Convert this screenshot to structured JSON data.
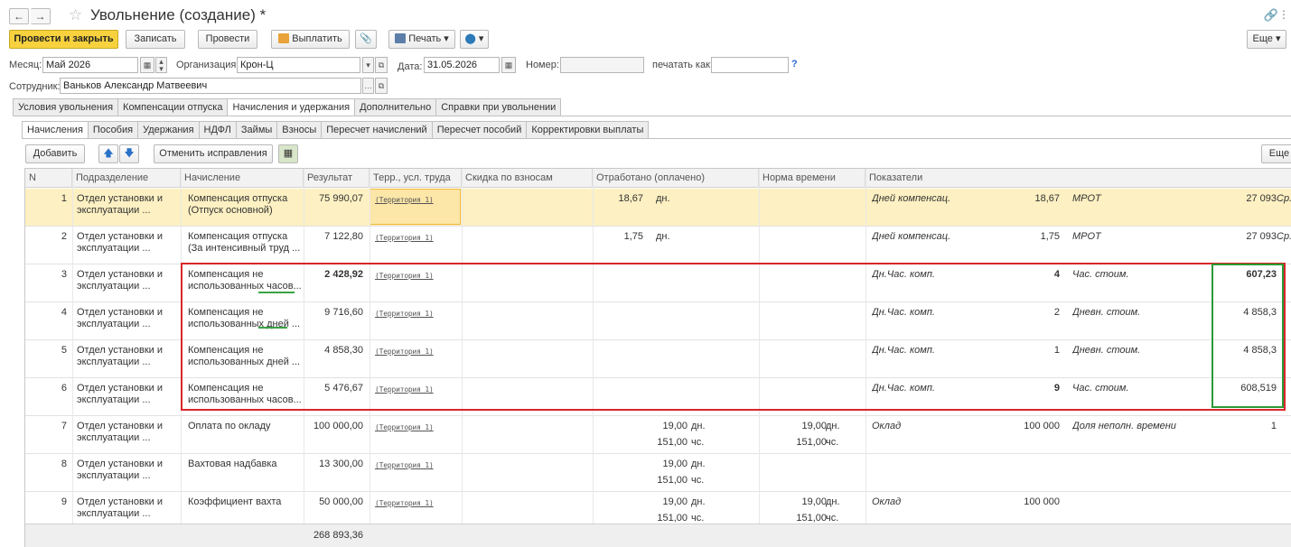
{
  "window": {
    "title": "Увольнение (создание) *",
    "back": "←",
    "forward": "→"
  },
  "toolbar": {
    "post_close": "Провести и закрыть",
    "save": "Записать",
    "post": "Провести",
    "pay": "Выплатить",
    "print": "Печать",
    "more": "Еще"
  },
  "fields": {
    "month_label": "Месяц:",
    "month_value": "Май 2026",
    "org_label": "Организация:",
    "org_value": "Крон-Ц",
    "date_label": "Дата:",
    "date_value": "31.05.2026",
    "number_label": "Номер:",
    "number_value": "",
    "print_as_label": "печатать как:",
    "print_as_value": "",
    "help": "?",
    "employee_label": "Сотрудник:",
    "employee_value": "Ваньков Александр Матвеевич"
  },
  "tabs": [
    "Условия увольнения",
    "Компенсации отпуска",
    "Начисления и удержания",
    "Дополнительно",
    "Справки при увольнении"
  ],
  "subtabs": [
    "Начисления",
    "Пособия",
    "Удержания",
    "НДФЛ",
    "Займы",
    "Взносы",
    "Пересчет начислений",
    "Пересчет пособий",
    "Корректировки выплаты"
  ],
  "table_toolbar": {
    "add": "Добавить",
    "cancel_fix": "Отменить исправления",
    "more": "Еще"
  },
  "columns": [
    "N",
    "Подразделение",
    "Начисление",
    "Результат",
    "Терр., усл. труда",
    "Скидка по взносам",
    "Отработано (оплачено)",
    "Норма времени",
    "Показатели"
  ],
  "rows": [
    {
      "n": "1",
      "dept": [
        "Отдел установки и",
        "эксплуатации ..."
      ],
      "accrual": [
        "Компенсация отпуска",
        "(Отпуск основной)"
      ],
      "result": "75 990,07",
      "terr": "(Территория 1)",
      "worked": [
        [
          "18,67",
          "дн."
        ]
      ],
      "norm": [],
      "ind1_name": "Дней компенсац.",
      "ind1_val": "18,67",
      "ind2_name": "МРОТ",
      "ind2_val": "27 093",
      "ind3": "Ср."
    },
    {
      "n": "2",
      "dept": [
        "Отдел установки и",
        "эксплуатации ..."
      ],
      "accrual": [
        "Компенсация отпуска",
        "(За интенсивный труд ..."
      ],
      "result": "7 122,80",
      "terr": "(Территория 1)",
      "worked": [
        [
          "1,75",
          "дн."
        ]
      ],
      "norm": [],
      "ind1_name": "Дней компенсац.",
      "ind1_val": "1,75",
      "ind2_name": "МРОТ",
      "ind2_val": "27 093",
      "ind3": "Ср."
    },
    {
      "n": "3",
      "dept": [
        "Отдел установки и",
        "эксплуатации ..."
      ],
      "accrual": [
        "Компенсация не",
        "использованных часов..."
      ],
      "result": "2 428,92",
      "terr": "(Территория 1)",
      "worked": [],
      "norm": [],
      "ind1_name": "Дн.Час. комп.",
      "ind1_val": "4",
      "ind2_name": "Час. стоим.",
      "ind2_val": "607,23",
      "ind3": ""
    },
    {
      "n": "4",
      "dept": [
        "Отдел установки и",
        "эксплуатации ..."
      ],
      "accrual": [
        "Компенсация не",
        "использованных дней ..."
      ],
      "result": "9 716,60",
      "terr": "(Территория 1)",
      "worked": [],
      "norm": [],
      "ind1_name": "Дн.Час. комп.",
      "ind1_val": "2",
      "ind2_name": "Дневн. стоим.",
      "ind2_val": "4 858,3",
      "ind3": ""
    },
    {
      "n": "5",
      "dept": [
        "Отдел установки и",
        "эксплуатации ..."
      ],
      "accrual": [
        "Компенсация не",
        "использованных дней ..."
      ],
      "result": "4 858,30",
      "terr": "(Территория 1)",
      "worked": [],
      "norm": [],
      "ind1_name": "Дн.Час. комп.",
      "ind1_val": "1",
      "ind2_name": "Дневн. стоим.",
      "ind2_val": "4 858,3",
      "ind3": ""
    },
    {
      "n": "6",
      "dept": [
        "Отдел установки и",
        "эксплуатации ..."
      ],
      "accrual": [
        "Компенсация не",
        "использованных часов..."
      ],
      "result": "5 476,67",
      "terr": "(Территория 1)",
      "worked": [],
      "norm": [],
      "ind1_name": "Дн.Час. комп.",
      "ind1_val": "9",
      "ind2_name": "Час. стоим.",
      "ind2_val": "608,519",
      "ind3": ""
    },
    {
      "n": "7",
      "dept": [
        "Отдел установки и",
        "эксплуатации ..."
      ],
      "accrual": [
        "Оплата по окладу",
        ""
      ],
      "result": "100 000,00",
      "terr": "(Территория 1)",
      "worked": [
        [
          "19,00",
          "дн."
        ],
        [
          "151,00",
          "чс."
        ]
      ],
      "norm": [
        [
          "19,00",
          "дн."
        ],
        [
          "151,00",
          "чс."
        ]
      ],
      "ind1_name": "Оклад",
      "ind1_val": "100 000",
      "ind2_name": "Доля неполн. времени",
      "ind2_val": "1",
      "ind3": ""
    },
    {
      "n": "8",
      "dept": [
        "Отдел установки и",
        "эксплуатации ..."
      ],
      "accrual": [
        "Вахтовая надбавка",
        ""
      ],
      "result": "13 300,00",
      "terr": "(Территория 1)",
      "worked": [
        [
          "19,00",
          "дн."
        ],
        [
          "151,00",
          "чс."
        ]
      ],
      "norm": [],
      "ind1_name": "",
      "ind1_val": "",
      "ind2_name": "",
      "ind2_val": "",
      "ind3": ""
    },
    {
      "n": "9",
      "dept": [
        "Отдел установки и",
        "эксплуатации ..."
      ],
      "accrual": [
        "Коэффициент вахта",
        ""
      ],
      "result": "50 000,00",
      "terr": "(Территория 1)",
      "worked": [
        [
          "19,00",
          "дн."
        ],
        [
          "151,00",
          "чс."
        ]
      ],
      "norm": [
        [
          "19,00",
          "дн."
        ],
        [
          "151,00",
          "чс."
        ]
      ],
      "ind1_name": "Оклад",
      "ind1_val": "100 000",
      "ind2_name": "",
      "ind2_val": "",
      "ind3": ""
    }
  ],
  "total": "268 893,36",
  "colors": {
    "accent": "#f7d23e",
    "selected_row": "#fdf0c2",
    "highlight_red": "#d9262b",
    "highlight_green": "#2a9a35"
  }
}
